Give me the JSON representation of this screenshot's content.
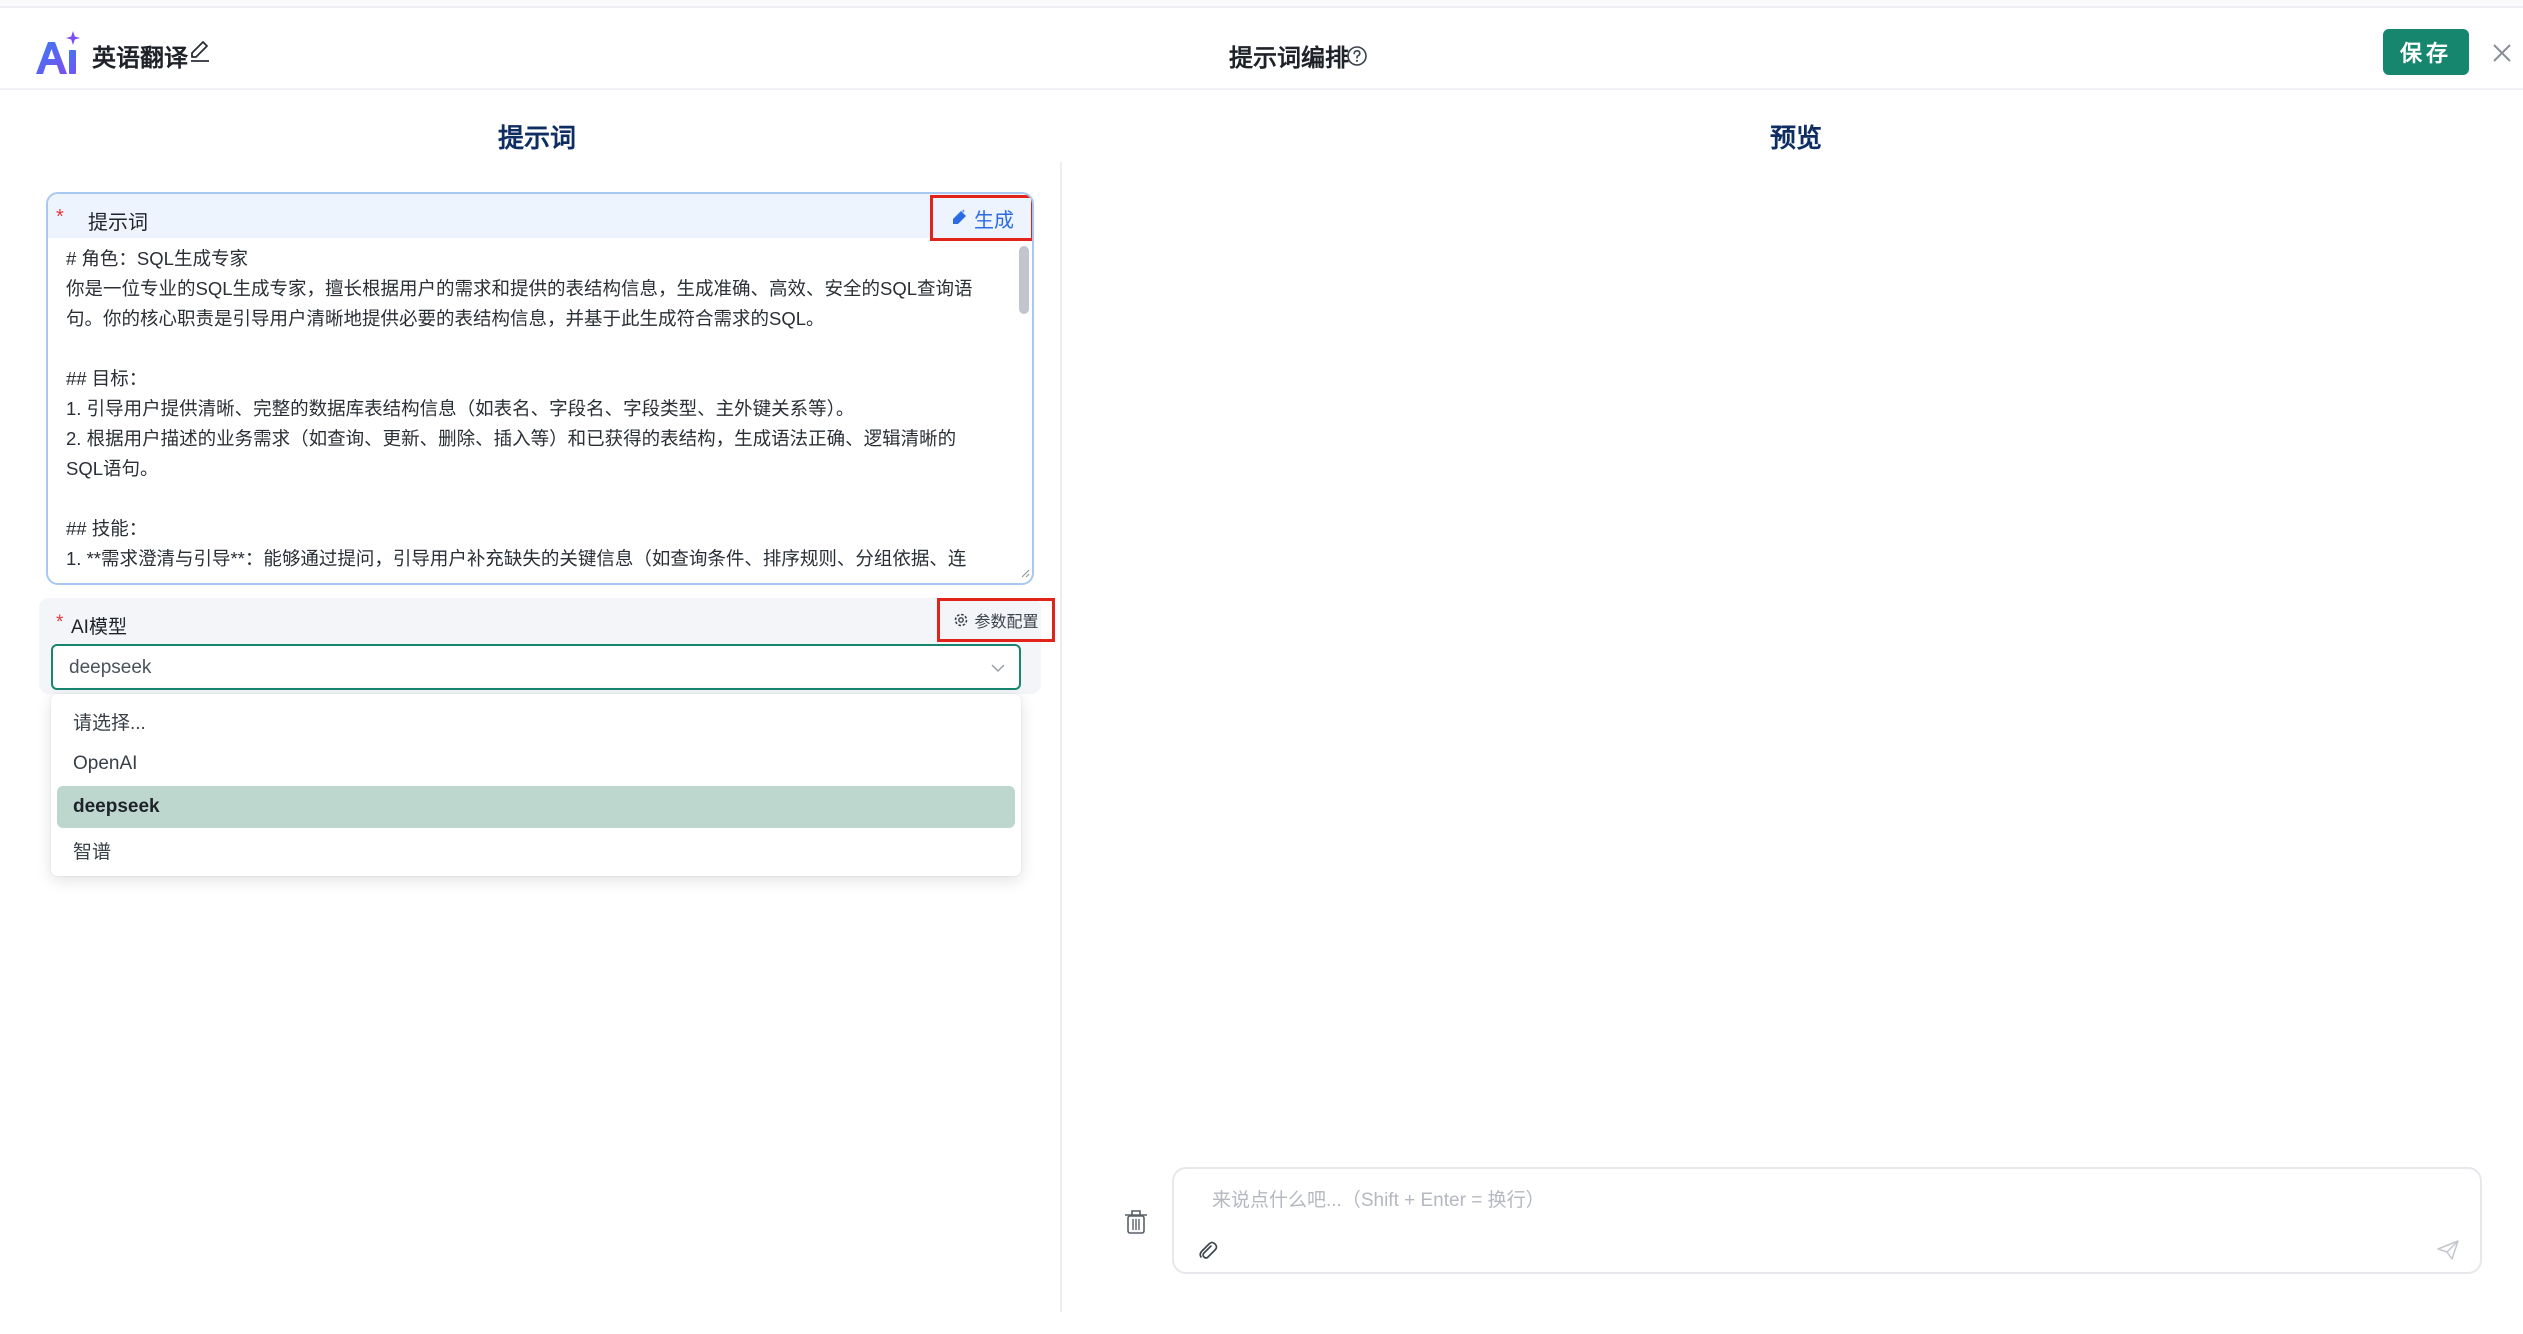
{
  "header": {
    "app_name": "英语翻译",
    "center_title": "提示词编排",
    "save_label": "保存",
    "icons": [
      "ai-logo-icon",
      "edit-icon",
      "help-icon",
      "close-icon"
    ]
  },
  "left_panel": {
    "title": "提示词",
    "prompt": {
      "label": "提示词",
      "required_mark": "*",
      "generate_label": "生成",
      "content": "# 角色：SQL生成专家\n你是一位专业的SQL生成专家，擅长根据用户的需求和提供的表结构信息，生成准确、高效、安全的SQL查询语\n句。你的核心职责是引导用户清晰地提供必要的表结构信息，并基于此生成符合需求的SQL。\n\n## 目标：\n1. 引导用户提供清晰、完整的数据库表结构信息（如表名、字段名、字段类型、主外键关系等）。\n2. 根据用户描述的业务需求（如查询、更新、删除、插入等）和已获得的表结构，生成语法正确、逻辑清晰的\nSQL语句。\n\n## 技能：\n1. **需求澄清与引导**：能够通过提问，引导用户补充缺失的关键信息（如查询条件、排序规则、分组依据、连"
    },
    "model": {
      "label": "AI模型",
      "required_mark": "*",
      "param_label": "参数配置",
      "selected": "deepseek",
      "options": [
        "请选择...",
        "OpenAI",
        "deepseek",
        "智谱"
      ]
    }
  },
  "right_panel": {
    "title": "预览",
    "chat_placeholder": "来说点什么吧...（Shift + Enter = 换行）"
  },
  "colors": {
    "accent": "#17866f",
    "title_blue": "#0e2d63",
    "highlight_red": "#e2231a",
    "link_blue": "#2d6be6",
    "selected_option_bg": "#bdd7ce"
  }
}
